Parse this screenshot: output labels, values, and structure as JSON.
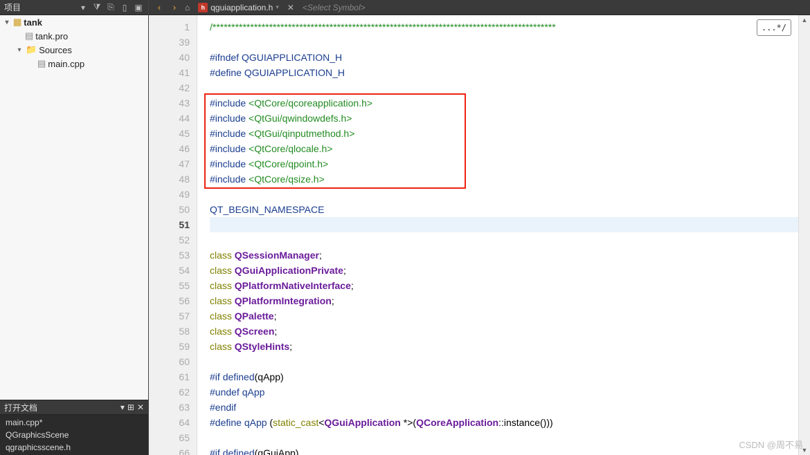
{
  "panels": {
    "project": {
      "title": "项目",
      "filter_icon": "▾",
      "funnel": "⧩",
      "link": "⎘",
      "split": "▯",
      "collapse": "▣"
    },
    "open_docs": {
      "title": "打开文档",
      "dropdown": "▾",
      "split": "⊞",
      "close": "✕"
    }
  },
  "project_tree": {
    "root": {
      "name": "tank",
      "expanded": true
    },
    "children": [
      {
        "name": "tank.pro",
        "type": "file"
      },
      {
        "name": "Sources",
        "type": "folder",
        "expanded": true,
        "children": [
          {
            "name": "main.cpp",
            "type": "file"
          }
        ]
      }
    ]
  },
  "open_docs": [
    "main.cpp*",
    "QGraphicsScene",
    "qgraphicsscene.h"
  ],
  "tab": {
    "filename": "qguiapplication.h",
    "close": "✕",
    "dropdown": "▾"
  },
  "symbol_selector": "<Select Symbol>",
  "collapse_badge": "...*/",
  "nav": {
    "back": "‹",
    "forward": "›",
    "bookmark": "⌂"
  },
  "editor": {
    "current_line": 51,
    "redbox": {
      "top_line": 43,
      "bottom_line": 48
    },
    "lines": [
      {
        "n": 1,
        "segs": [
          {
            "t": "/*******************************************************************************************",
            "c": "kw-comment"
          }
        ]
      },
      {
        "n": 39,
        "segs": []
      },
      {
        "n": 40,
        "segs": [
          {
            "t": "#ifndef ",
            "c": "kw-pre"
          },
          {
            "t": "QGUIAPPLICATION_H",
            "c": "kw-nav"
          }
        ]
      },
      {
        "n": 41,
        "segs": [
          {
            "t": "#define ",
            "c": "kw-pre"
          },
          {
            "t": "QGUIAPPLICATION_H",
            "c": "kw-nav"
          }
        ]
      },
      {
        "n": 42,
        "segs": []
      },
      {
        "n": 43,
        "segs": [
          {
            "t": "#include ",
            "c": "kw-pre"
          },
          {
            "t": "<QtCore/qcoreapplication.h>",
            "c": "kw-inc"
          }
        ]
      },
      {
        "n": 44,
        "segs": [
          {
            "t": "#include ",
            "c": "kw-pre"
          },
          {
            "t": "<QtGui/qwindowdefs.h>",
            "c": "kw-inc"
          }
        ]
      },
      {
        "n": 45,
        "segs": [
          {
            "t": "#include ",
            "c": "kw-pre"
          },
          {
            "t": "<QtGui/qinputmethod.h>",
            "c": "kw-inc"
          }
        ]
      },
      {
        "n": 46,
        "segs": [
          {
            "t": "#include ",
            "c": "kw-pre"
          },
          {
            "t": "<QtCore/qlocale.h>",
            "c": "kw-inc"
          }
        ]
      },
      {
        "n": 47,
        "segs": [
          {
            "t": "#include ",
            "c": "kw-pre"
          },
          {
            "t": "<QtCore/qpoint.h>",
            "c": "kw-inc"
          }
        ]
      },
      {
        "n": 48,
        "segs": [
          {
            "t": "#include ",
            "c": "kw-pre"
          },
          {
            "t": "<QtCore/qsize.h>",
            "c": "kw-inc"
          }
        ]
      },
      {
        "n": 49,
        "segs": []
      },
      {
        "n": 50,
        "segs": [
          {
            "t": "QT_BEGIN_NAMESPACE",
            "c": "kw-nav"
          }
        ]
      },
      {
        "n": 51,
        "segs": []
      },
      {
        "n": 52,
        "segs": []
      },
      {
        "n": 53,
        "segs": [
          {
            "t": "class ",
            "c": "kw-olive"
          },
          {
            "t": "QSessionManager",
            "c": "kw-type"
          },
          {
            "t": ";",
            "c": ""
          }
        ]
      },
      {
        "n": 54,
        "segs": [
          {
            "t": "class ",
            "c": "kw-olive"
          },
          {
            "t": "QGuiApplicationPrivate",
            "c": "kw-type"
          },
          {
            "t": ";",
            "c": ""
          }
        ]
      },
      {
        "n": 55,
        "segs": [
          {
            "t": "class ",
            "c": "kw-olive"
          },
          {
            "t": "QPlatformNativeInterface",
            "c": "kw-type"
          },
          {
            "t": ";",
            "c": ""
          }
        ]
      },
      {
        "n": 56,
        "segs": [
          {
            "t": "class ",
            "c": "kw-olive"
          },
          {
            "t": "QPlatformIntegration",
            "c": "kw-type"
          },
          {
            "t": ";",
            "c": ""
          }
        ]
      },
      {
        "n": 57,
        "segs": [
          {
            "t": "class ",
            "c": "kw-olive"
          },
          {
            "t": "QPalette",
            "c": "kw-type"
          },
          {
            "t": ";",
            "c": ""
          }
        ]
      },
      {
        "n": 58,
        "segs": [
          {
            "t": "class ",
            "c": "kw-olive"
          },
          {
            "t": "QScreen",
            "c": "kw-type"
          },
          {
            "t": ";",
            "c": ""
          }
        ]
      },
      {
        "n": 59,
        "segs": [
          {
            "t": "class ",
            "c": "kw-olive"
          },
          {
            "t": "QStyleHints",
            "c": "kw-type"
          },
          {
            "t": ";",
            "c": ""
          }
        ]
      },
      {
        "n": 60,
        "segs": []
      },
      {
        "n": 61,
        "segs": [
          {
            "t": "#if ",
            "c": "kw-pre"
          },
          {
            "t": "defined",
            "c": "kw-nav"
          },
          {
            "t": "(qApp)",
            "c": ""
          }
        ]
      },
      {
        "n": 62,
        "segs": [
          {
            "t": "#undef ",
            "c": "kw-pre"
          },
          {
            "t": "qApp",
            "c": "kw-nav"
          }
        ]
      },
      {
        "n": 63,
        "segs": [
          {
            "t": "#endif",
            "c": "kw-pre"
          }
        ]
      },
      {
        "n": 64,
        "segs": [
          {
            "t": "#define ",
            "c": "kw-pre"
          },
          {
            "t": "qApp ",
            "c": "kw-nav"
          },
          {
            "t": "(",
            "c": ""
          },
          {
            "t": "static_cast",
            "c": "kw-olive"
          },
          {
            "t": "<",
            "c": ""
          },
          {
            "t": "QGuiApplication",
            "c": "kw-type"
          },
          {
            "t": " *>(",
            "c": ""
          },
          {
            "t": "QCoreApplication",
            "c": "kw-type"
          },
          {
            "t": "::instance()))",
            "c": ""
          }
        ]
      },
      {
        "n": 65,
        "segs": []
      },
      {
        "n": 66,
        "segs": [
          {
            "t": "#if ",
            "c": "kw-pre"
          },
          {
            "t": "defined",
            "c": "kw-nav"
          },
          {
            "t": "(qGuiApp)",
            "c": ""
          }
        ]
      }
    ]
  },
  "watermark": "CSDN @周不易"
}
